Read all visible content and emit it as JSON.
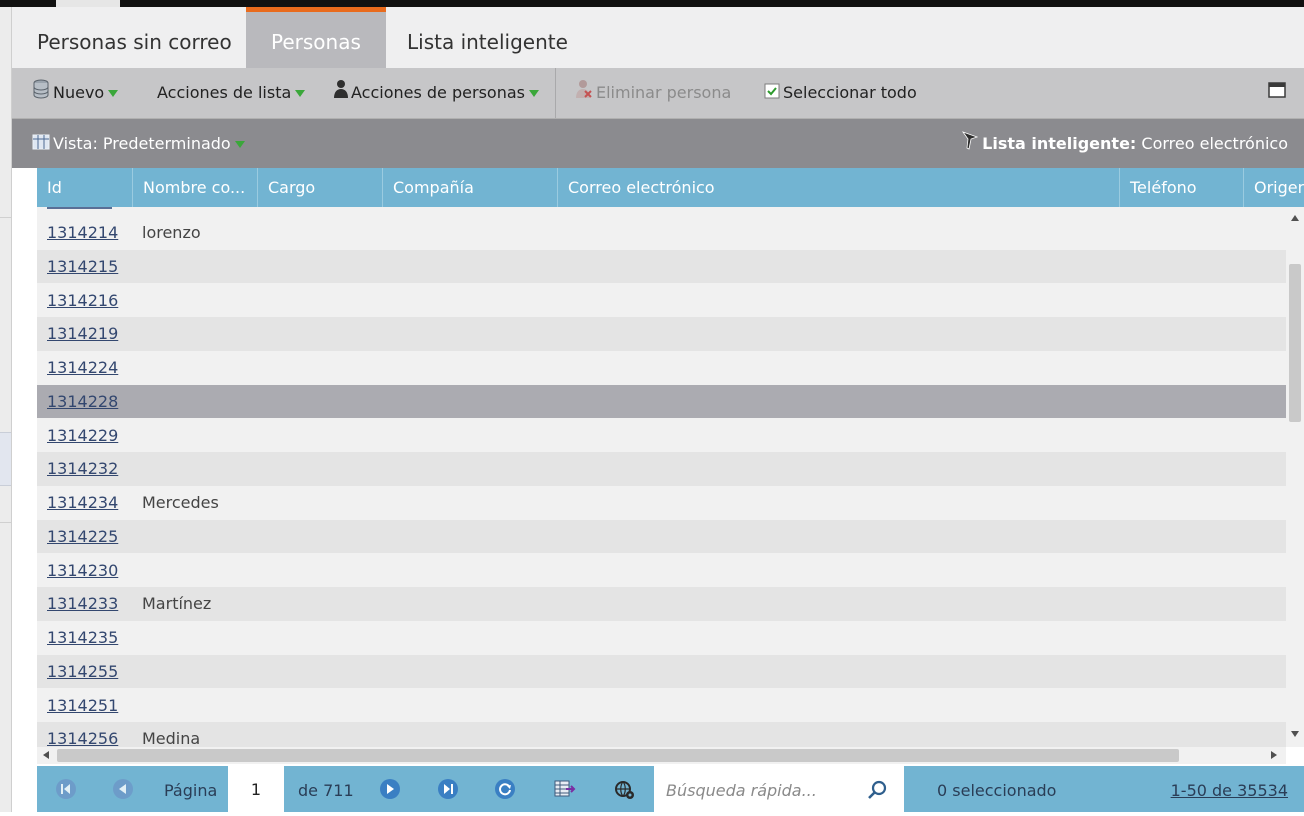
{
  "tabs": [
    {
      "label": "Personas sin correo",
      "active": false
    },
    {
      "label": "Personas",
      "active": true
    },
    {
      "label": "Lista inteligente",
      "active": false
    }
  ],
  "toolbar": {
    "new_label": "Nuevo",
    "list_actions_label": "Acciones de lista",
    "person_actions_label": "Acciones de personas",
    "delete_label": "Eliminar persona",
    "select_all_label": "Seleccionar todo"
  },
  "viewbar": {
    "view_label": "Vista: Predeterminado",
    "smart_list_prefix": "Lista inteligente:",
    "smart_list_value": "Correo electrónico"
  },
  "columns": [
    "Id",
    "Nombre co...",
    "Cargo",
    "Compañía",
    "Correo electrónico",
    "Teléfono",
    "Origen"
  ],
  "rows": [
    {
      "id": "1314214",
      "name": "lorenzo",
      "selected": false
    },
    {
      "id": "1314215",
      "name": "",
      "selected": false
    },
    {
      "id": "1314216",
      "name": "",
      "selected": false
    },
    {
      "id": "1314219",
      "name": "",
      "selected": false
    },
    {
      "id": "1314224",
      "name": "",
      "selected": false
    },
    {
      "id": "1314228",
      "name": "",
      "selected": true
    },
    {
      "id": "1314229",
      "name": "",
      "selected": false
    },
    {
      "id": "1314232",
      "name": "",
      "selected": false
    },
    {
      "id": "1314234",
      "name": "Mercedes",
      "selected": false
    },
    {
      "id": "1314225",
      "name": "",
      "selected": false
    },
    {
      "id": "1314230",
      "name": "",
      "selected": false
    },
    {
      "id": "1314233",
      "name": "Martínez",
      "selected": false
    },
    {
      "id": "1314235",
      "name": "",
      "selected": false
    },
    {
      "id": "1314255",
      "name": "",
      "selected": false
    },
    {
      "id": "1314251",
      "name": "",
      "selected": false
    },
    {
      "id": "1314256",
      "name": "Medina",
      "selected": false
    }
  ],
  "pager": {
    "page_label": "Página",
    "page_value": "1",
    "of_label": "de 711",
    "search_placeholder": "Búsqueda rápida...",
    "selected_count": "0 seleccionado",
    "range_label": "1-50 de 35534"
  },
  "colors": {
    "accent_orange": "#e96b1d",
    "grid_header": "#72b4d2",
    "toolbar": "#c6c6c8",
    "viewbar": "#8b8b8f",
    "selected_row": "#ababb1"
  }
}
